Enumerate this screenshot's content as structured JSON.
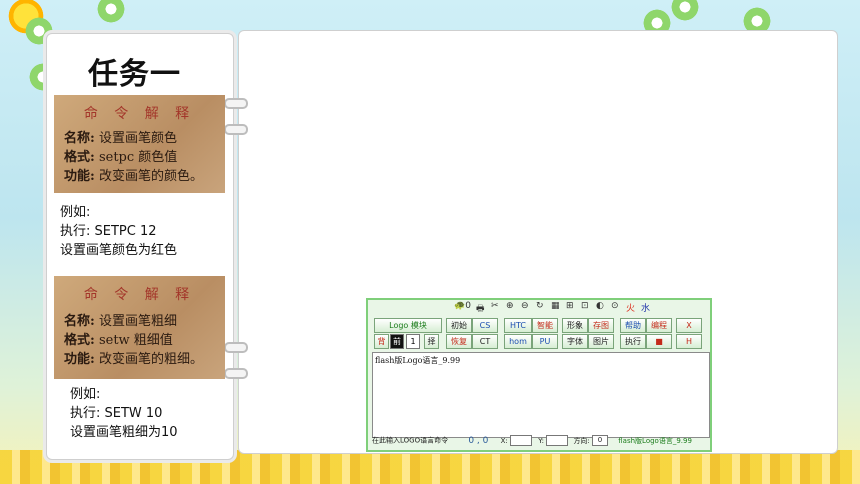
{
  "slide": {
    "title": "任务一"
  },
  "card1": {
    "heading": "命 令 解 释",
    "name_label": "名称:",
    "name_value": "设置画笔颜色",
    "format_label": "格式:",
    "format_value": "setpc  颜色值",
    "function_label": "功能:",
    "function_value": "改变画笔的颜色。"
  },
  "example1": {
    "line1": "例如:",
    "line2": "执行: SETPC  12",
    "line3": "设置画笔颜色为红色"
  },
  "card2": {
    "heading": "命 令 解 释",
    "name_label": "名称:",
    "name_value": "设置画笔粗细",
    "format_label": "格式:",
    "format_value": "setw   粗细值",
    "function_label": "功能:",
    "function_value": "改变画笔的粗细。"
  },
  "example2": {
    "line1": "例如:",
    "line2": "执行: SETW  10",
    "line3": "设置画笔粗细为10"
  },
  "app": {
    "icon_bar": [
      "🐢0",
      "🖶",
      "✂",
      "⊕",
      "⊖",
      "↻",
      "▦",
      "⊞",
      "⊡",
      "◐",
      "⊙",
      "火",
      "水"
    ],
    "module_button": "Logo 模块",
    "buttons_row1": [
      "初始",
      "CS",
      "HTC",
      "智能",
      "形象",
      "存图",
      "帮助",
      "编程",
      "X"
    ],
    "buttons_row2": [
      "恢复",
      "CT",
      "hom",
      "PU",
      "字体",
      "图片",
      "执行",
      "■",
      "H"
    ],
    "bg_label": "背",
    "fg_label": "前",
    "width_value": "1",
    "extra_label": "择",
    "editor_text": "flash版Logo语言_9.99",
    "status_prompt": "在此输入LOGO语言命令",
    "coords": "0 , 0",
    "x_label": "X:",
    "y_label": "Y:",
    "dir_label": "方向:",
    "dir_value": "0",
    "status_name": "flash版Logo语言_9.99"
  }
}
